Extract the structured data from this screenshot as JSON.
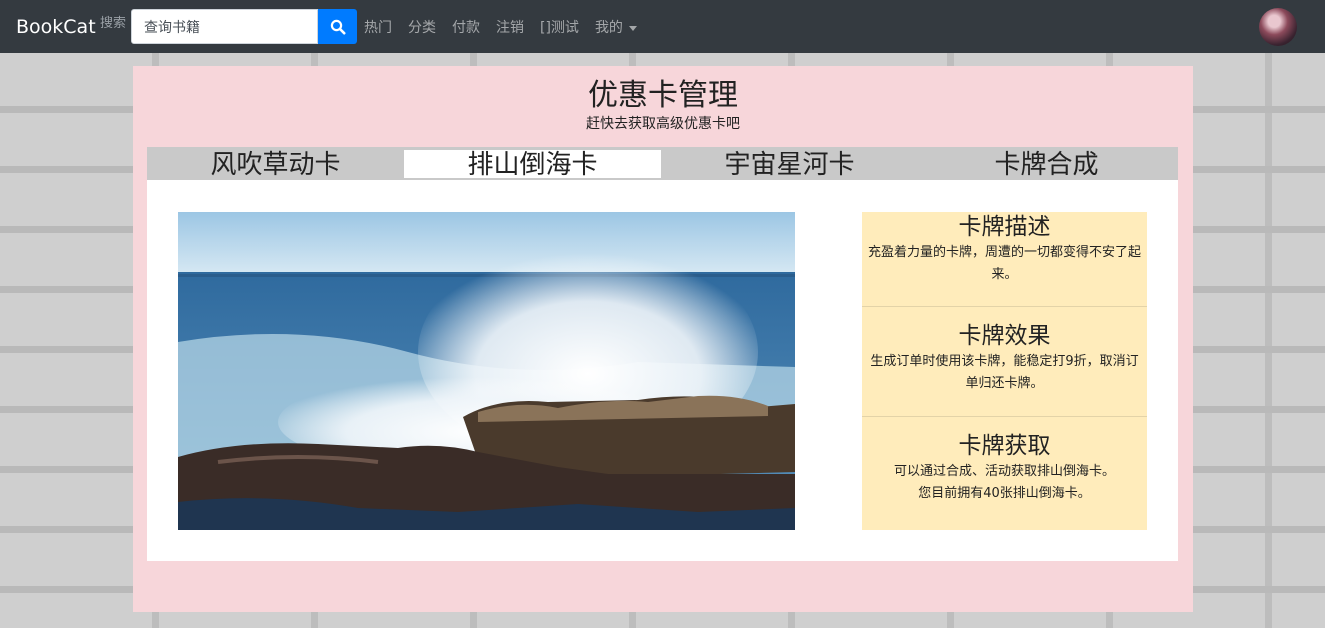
{
  "navbar": {
    "brand": "BookCat",
    "search_label": "搜索",
    "search_placeholder": "查询书籍",
    "items": [
      {
        "label": "热门"
      },
      {
        "label": "分类"
      },
      {
        "label": "付款"
      },
      {
        "label": "注销"
      },
      {
        "label": "[]测试"
      },
      {
        "label": "我的"
      }
    ]
  },
  "page": {
    "title": "优惠卡管理",
    "subtitle": "赶快去获取高级优惠卡吧"
  },
  "tabs": [
    {
      "label": "风吹草动卡",
      "active": false
    },
    {
      "label": "排山倒海卡",
      "active": true
    },
    {
      "label": "宇宙星河卡",
      "active": false
    },
    {
      "label": "卡牌合成",
      "active": false
    }
  ],
  "card_info": {
    "description_title": "卡牌描述",
    "description_text": "充盈着力量的卡牌，周遭的一切都变得不安了起来。",
    "effect_title": "卡牌效果",
    "effect_text": "生成订单时使用该卡牌，能稳定打9折，取消订单归还卡牌。",
    "obtain_title": "卡牌获取",
    "obtain_text_1": "可以通过合成、活动获取排山倒海卡。",
    "obtain_text_2": "您目前拥有40张排山倒海卡。"
  },
  "colors": {
    "navbar_bg": "#343a40",
    "search_button": "#007bff",
    "panel_bg": "#f7d6da",
    "info_bg": "#ffecbb"
  }
}
